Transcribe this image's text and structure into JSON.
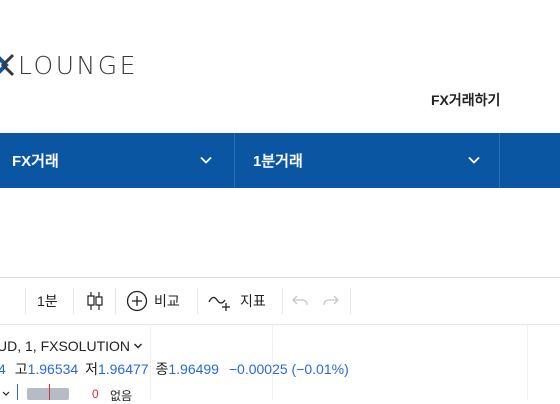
{
  "header": {
    "logo_text": "LOUNGE",
    "top_link": "FX거래하기"
  },
  "nav": {
    "items": [
      {
        "label": "FX거래"
      },
      {
        "label": "1분거래"
      }
    ]
  },
  "toolbar": {
    "interval": "1분",
    "compare": "비교",
    "indicators": "지표"
  },
  "chart": {
    "symbol": "UD, 1, FXSOLUTION",
    "ohlc": {
      "open_label": "4",
      "high_label": "고",
      "high": "1.96534",
      "low_label": "저",
      "low": "1.96477",
      "close_label": "종",
      "close": "1.96499",
      "change": "−0.00025 (−0.01%)"
    },
    "bottom_value": "0",
    "bottom_text": "없음"
  },
  "colors": {
    "nav_bg": "#0b56a3",
    "value_blue": "#2a6ad8"
  }
}
